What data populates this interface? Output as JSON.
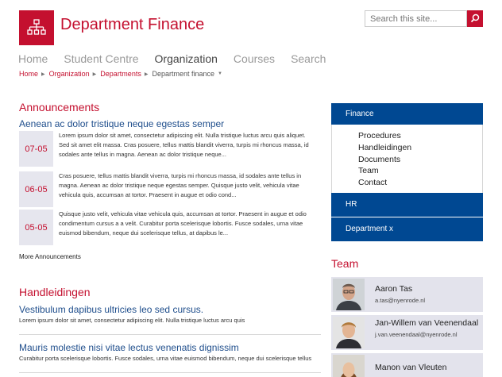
{
  "site": {
    "title": "Department Finance",
    "brand_color": "#c4102f",
    "accent_blue": "#004892"
  },
  "search": {
    "placeholder": "Search this site..."
  },
  "nav": [
    {
      "label": "Home",
      "active": false
    },
    {
      "label": "Student Centre",
      "active": false
    },
    {
      "label": "Organization",
      "active": true
    },
    {
      "label": "Courses",
      "active": false
    },
    {
      "label": "Search",
      "active": false
    }
  ],
  "breadcrumb": {
    "links": [
      "Home",
      "Organization",
      "Departments"
    ],
    "current": "Department finance"
  },
  "announcements": {
    "title": "Announcements",
    "featured_title": "Aenean ac dolor tristique neque egestas semper",
    "items": [
      {
        "date": "07-05",
        "text": "Lorem ipsum dolor sit amet, consectetur adipiscing elit. Nulla tristique luctus arcu quis aliquet. Sed sit amet elit massa. Cras posuere, tellus mattis blandit viverra, turpis mi rhoncus massa, id sodales ante tellus in magna. Aenean ac dolor tristique neque..."
      },
      {
        "date": "06-05",
        "text": "Cras posuere, tellus mattis blandit viverra, turpis mi rhoncus massa, id sodales ante tellus in magna. Aenean ac dolor tristique neque egestas semper. Quisque justo velit, vehicula vitae vehicula quis, accumsan at tortor. Praesent in augue et odio cond..."
      },
      {
        "date": "05-05",
        "text": "Quisque justo velit, vehicula vitae vehicula quis, accumsan at tortor. Praesent in augue et odio condimentum cursus a a velit. Curabitur porta scelerisque lobortis. Fusce sodales, urna vitae euismod bibendum, neque dui scelerisque tellus, at dapibus le..."
      }
    ],
    "more_label": "More Announcements"
  },
  "handleidingen": {
    "title": "Handleidingen",
    "items": [
      {
        "title": "Vestibulum dapibus ultricies leo sed cursus.",
        "snippet": "Lorem ipsum dolor sit amet, consectetur adipiscing elit. Nulla tristique luctus arcu quis"
      },
      {
        "title": "Mauris molestie nisi vitae lectus venenatis dignissim",
        "snippet": "Curabitur porta scelerisque lobortis. Fusce sodales, urna vitae euismod bibendum, neque dui scelerisque tellus"
      }
    ]
  },
  "sidebar": {
    "sections": [
      {
        "label": "Finance",
        "subitems": [
          "Procedures",
          "Handleidingen",
          "Documents",
          "Team",
          "Contact"
        ]
      },
      {
        "label": "HR"
      },
      {
        "label": "Department x"
      }
    ]
  },
  "team": {
    "title": "Team",
    "members": [
      {
        "name": "Aaron Tas",
        "email": "a.tas@nyenrode.nl"
      },
      {
        "name": "Jan-Willem van Veenendaal",
        "email": "j.van.veenendaal@nyenrode.nl"
      },
      {
        "name": "Manon van Vleuten",
        "email": ""
      }
    ]
  }
}
